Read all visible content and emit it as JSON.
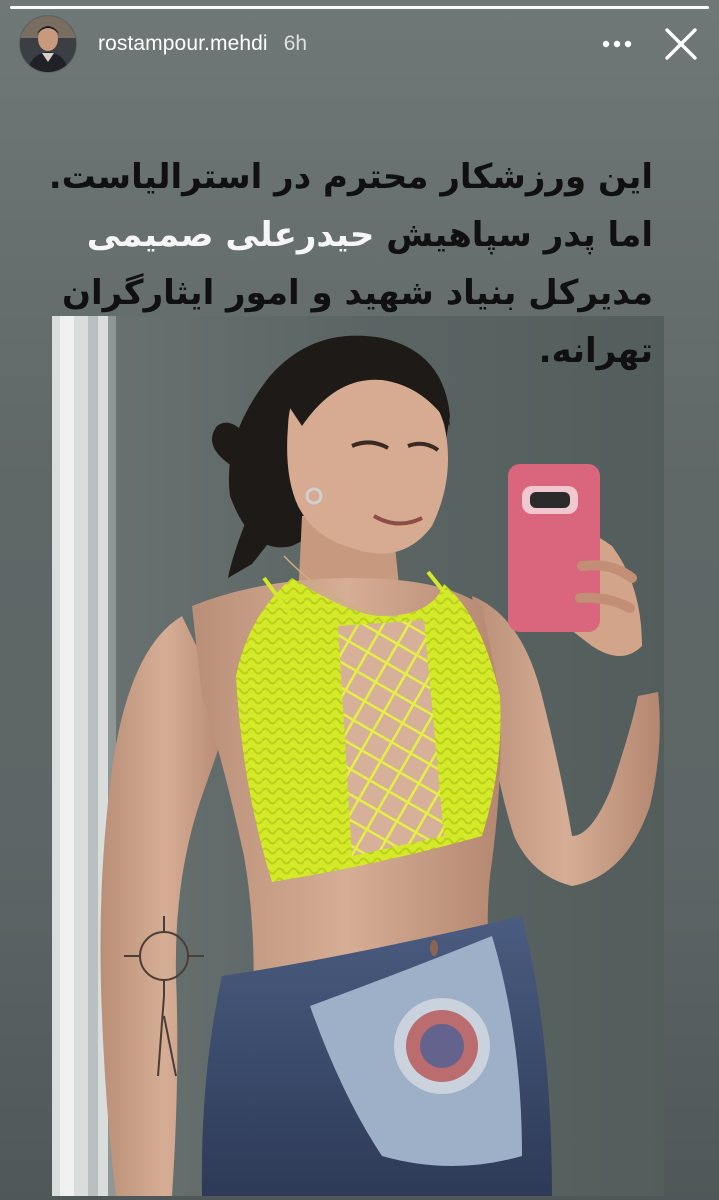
{
  "story": {
    "progress": 0.0,
    "user": {
      "username": "rostampour.mehdi",
      "time_ago": "6h",
      "avatar_icon": "profile-avatar"
    },
    "controls": {
      "more_icon": "more-horizontal-icon",
      "close_icon": "close-icon"
    },
    "caption": {
      "line1": "این ورزشکار محترم در استرالیاست.",
      "line2_pre": "اما پدر سپاهیش ",
      "line2_highlight": "حیدرعلی صمیمی",
      "line3": "مدیرکل بنیاد شهید و امور ایثارگران",
      "line4": "تهرانه."
    },
    "photo": {
      "description_icon": "story-photo"
    },
    "colors": {
      "background_top": "#6f7876",
      "background_bottom": "#4f5758",
      "caption_text": "#101010",
      "caption_highlight": "#f6f6f6",
      "top_color": "#d8ec2a"
    }
  }
}
